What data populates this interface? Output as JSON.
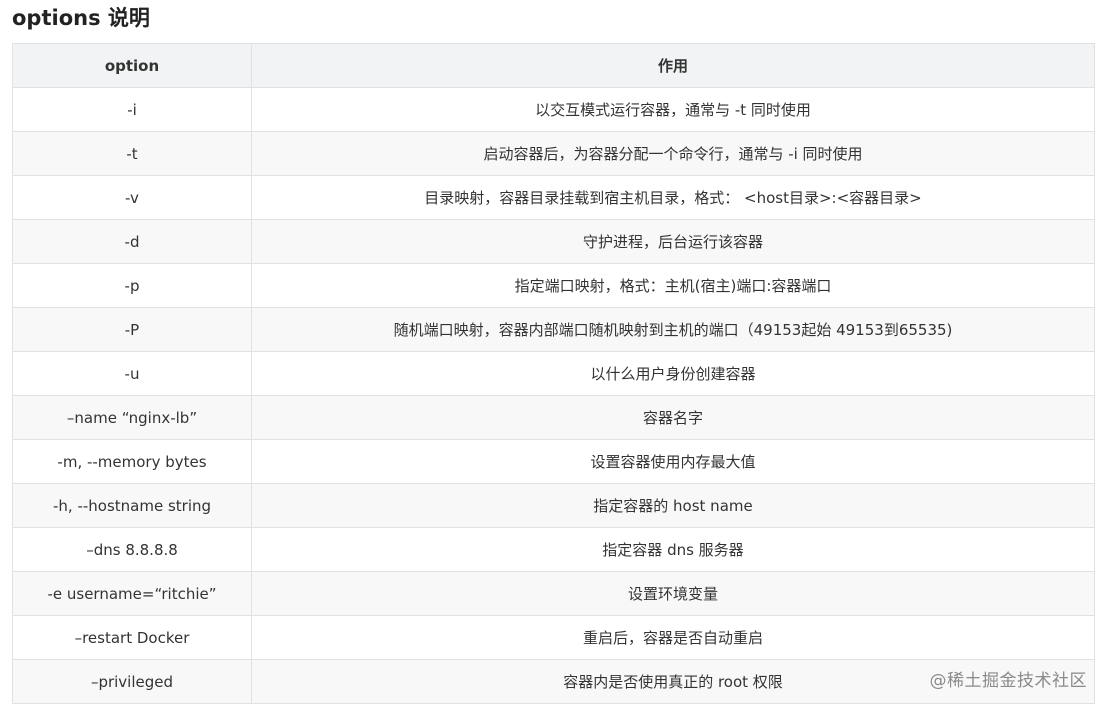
{
  "heading": "options 说明",
  "table": {
    "headers": [
      "option",
      "作用"
    ],
    "rows": [
      {
        "option": "-i",
        "desc": "以交互模式运行容器，通常与 -t 同时使用"
      },
      {
        "option": "-t",
        "desc": "启动容器后，为容器分配一个命令行，通常与 -i 同时使用"
      },
      {
        "option": "-v",
        "desc": "目录映射，容器目录挂载到宿主机目录，格式： <host目录>:<容器目录>"
      },
      {
        "option": "-d",
        "desc": "守护进程，后台运行该容器"
      },
      {
        "option": "-p",
        "desc": "指定端口映射，格式：主机(宿主)端口:容器端口"
      },
      {
        "option": "-P",
        "desc": "随机端口映射，容器内部端口随机映射到主机的端口（49153起始 49153到65535)"
      },
      {
        "option": "-u",
        "desc": "以什么用户身份创建容器"
      },
      {
        "option": "–name “nginx-lb”",
        "desc": "容器名字"
      },
      {
        "option": "-m, --memory bytes",
        "desc": "设置容器使用内存最大值"
      },
      {
        "option": "-h, --hostname string",
        "desc": "指定容器的 host name"
      },
      {
        "option": "–dns 8.8.8.8",
        "desc": "指定容器 dns 服务器"
      },
      {
        "option": "-e username=“ritchie”",
        "desc": "设置环境变量"
      },
      {
        "option": "–restart Docker",
        "desc": "重启后，容器是否自动重启"
      },
      {
        "option": "–privileged",
        "desc": "容器内是否使用真正的 root 权限"
      }
    ]
  },
  "watermark": "@稀土掘金技术社区"
}
